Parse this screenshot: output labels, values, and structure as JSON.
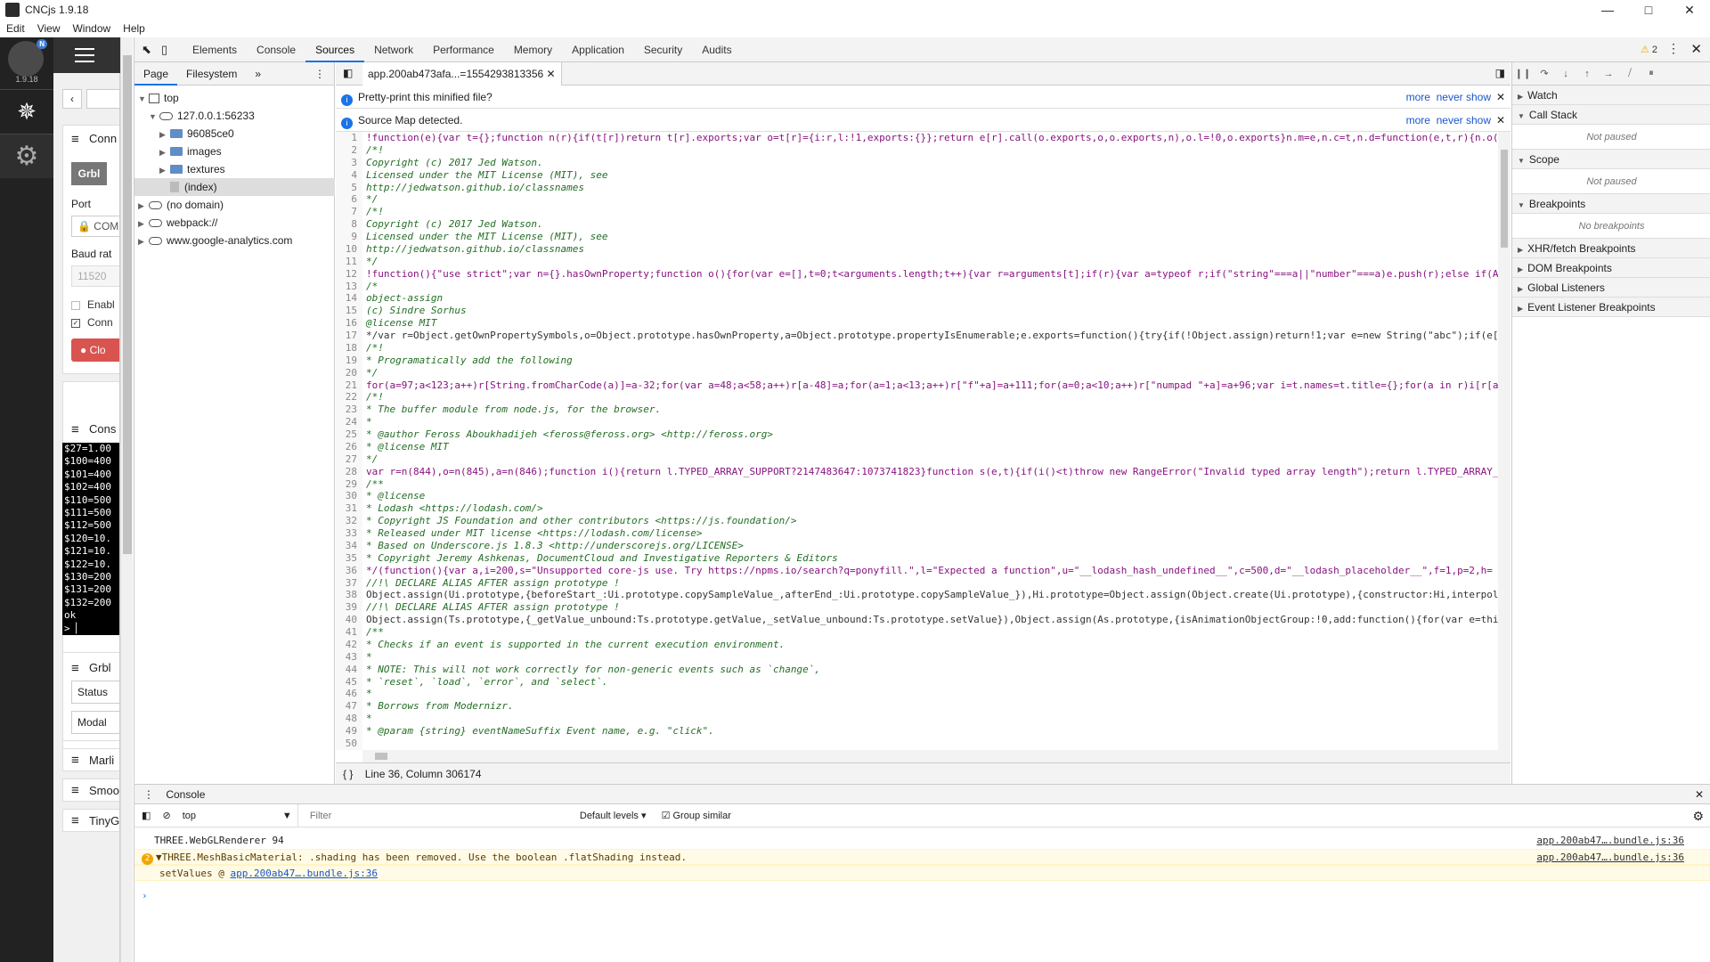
{
  "window": {
    "title": "CNCjs 1.9.18",
    "controls": [
      "—",
      "□",
      "✕"
    ]
  },
  "menu": [
    "Edit",
    "View",
    "Window",
    "Help"
  ],
  "cnc": {
    "version": "1.9.18",
    "logo_badge": "N",
    "widgets": {
      "connection_title": "Conn",
      "controller_button": "Grbl",
      "port_label": "Port",
      "port_value": "COM",
      "baud_label": "Baud rat",
      "baud_value": "11520",
      "enable_label": "Enabl",
      "conn_label": "Conn",
      "close_button": "Clo",
      "console_title": "Cons",
      "console_lines": [
        "$27=1.00",
        "$100=400",
        "$101=400",
        "$102=400",
        "$110=500",
        "$111=500",
        "$112=500",
        "$120=10.",
        "$121=10.",
        "$122=10.",
        "$130=200",
        "$131=200",
        "$132=200",
        "ok",
        "> ▏"
      ],
      "grbl_title": "Grbl",
      "status_tab": "Status",
      "modal_tab": "Modal",
      "marlin_title": "Marli",
      "smoothie_title": "Smoo",
      "tinyg_title": "TinyG"
    }
  },
  "devtools": {
    "tabs": [
      "Elements",
      "Console",
      "Sources",
      "Network",
      "Performance",
      "Memory",
      "Application",
      "Security",
      "Audits"
    ],
    "active_tab": "Sources",
    "warning_count": "2",
    "navigator": {
      "tabs": [
        "Page",
        "Filesystem"
      ],
      "tree": [
        {
          "label": "top",
          "level": 0,
          "icon": "frame",
          "arrow": "▼"
        },
        {
          "label": "127.0.0.1:56233",
          "level": 1,
          "icon": "cloud",
          "arrow": "▼"
        },
        {
          "label": "96085ce0",
          "level": 2,
          "icon": "folder",
          "arrow": "▶"
        },
        {
          "label": "images",
          "level": 2,
          "icon": "folder",
          "arrow": "▶"
        },
        {
          "label": "textures",
          "level": 2,
          "icon": "folder",
          "arrow": "▶"
        },
        {
          "label": "(index)",
          "level": 2,
          "icon": "file",
          "arrow": "",
          "selected": true
        },
        {
          "label": "(no domain)",
          "level": 0,
          "icon": "cloud",
          "arrow": "▶"
        },
        {
          "label": "webpack://",
          "level": 0,
          "icon": "cloud",
          "arrow": "▶"
        },
        {
          "label": "www.google-analytics.com",
          "level": 0,
          "icon": "cloud",
          "arrow": "▶"
        }
      ]
    },
    "editor": {
      "file_tab": "app.200ab473afa...=1554293813356",
      "infobars": [
        {
          "text": "Pretty-print this minified file?",
          "more": "more",
          "never": "never show"
        },
        {
          "text": "Source Map detected.",
          "more": "more",
          "never": "never show"
        }
      ],
      "lines": [
        {
          "n": "1",
          "t": "!function(e){var t={};function n(r){if(t[r])return t[r].exports;var o=t[r]={i:r,l:!1,exports:{}};return e[r].call(o.exports,o,o.exports,n),o.l=!0,o.exports}n.m=e,n.c=t,n.d=function(e,t,r){n.o(",
          "c": "k"
        },
        {
          "n": "2",
          "t": "/*!",
          "c": "c"
        },
        {
          "n": "3",
          "t": "  Copyright (c) 2017 Jed Watson.",
          "c": "c"
        },
        {
          "n": "4",
          "t": "  Licensed under the MIT License (MIT), see",
          "c": "c"
        },
        {
          "n": "5",
          "t": "  http://jedwatson.github.io/classnames",
          "c": "c"
        },
        {
          "n": "6",
          "t": "*/",
          "c": "c"
        },
        {
          "n": "7",
          "t": "/*!",
          "c": "c"
        },
        {
          "n": "8",
          "t": "  Copyright (c) 2017 Jed Watson.",
          "c": "c"
        },
        {
          "n": "9",
          "t": "  Licensed under the MIT License (MIT), see",
          "c": "c"
        },
        {
          "n": "10",
          "t": "  http://jedwatson.github.io/classnames",
          "c": "c"
        },
        {
          "n": "11",
          "t": "*/",
          "c": "c"
        },
        {
          "n": "12",
          "t": "!function(){\"use strict\";var n={}.hasOwnProperty;function o(){for(var e=[],t=0;t<arguments.length;t++){var r=arguments[t];if(r){var a=typeof r;if(\"string\"===a||\"number\"===a)e.push(r);else if(A",
          "c": "k"
        },
        {
          "n": "13",
          "t": "/*",
          "c": "c"
        },
        {
          "n": "14",
          "t": "object-assign",
          "c": "c"
        },
        {
          "n": "15",
          "t": "(c) Sindre Sorhus",
          "c": "c"
        },
        {
          "n": "16",
          "t": "@license MIT",
          "c": "c"
        },
        {
          "n": "17",
          "t": "*/var r=Object.getOwnPropertySymbols,o=Object.prototype.hasOwnProperty,a=Object.prototype.propertyIsEnumerable;e.exports=function(){try{if(!Object.assign)return!1;var e=new String(\"abc\");if(e[",
          "c": ""
        },
        {
          "n": "18",
          "t": "/*!",
          "c": "c"
        },
        {
          "n": "19",
          "t": " * Programatically add the following",
          "c": "c"
        },
        {
          "n": "20",
          "t": " */",
          "c": "c"
        },
        {
          "n": "21",
          "t": "for(a=97;a<123;a++)r[String.fromCharCode(a)]=a-32;for(var a=48;a<58;a++)r[a-48]=a;for(a=1;a<13;a++)r[\"f\"+a]=a+111;for(a=0;a<10;a++)r[\"numpad \"+a]=a+96;var i=t.names=t.title={};for(a in r)i[r[a",
          "c": "k"
        },
        {
          "n": "22",
          "t": "/*!",
          "c": "c"
        },
        {
          "n": "23",
          "t": " * The buffer module from node.js, for the browser.",
          "c": "c"
        },
        {
          "n": "24",
          "t": " *",
          "c": "c"
        },
        {
          "n": "25",
          "t": " * @author   Feross Aboukhadijeh <feross@feross.org> <http://feross.org>",
          "c": "c"
        },
        {
          "n": "26",
          "t": " * @license  MIT",
          "c": "c"
        },
        {
          "n": "27",
          "t": " */",
          "c": "c"
        },
        {
          "n": "28",
          "t": "var r=n(844),o=n(845),a=n(846);function i(){return l.TYPED_ARRAY_SUPPORT?2147483647:1073741823}function s(e,t){if(i()<t)throw new RangeError(\"Invalid typed array length\");return l.TYPED_ARRAY_",
          "c": "k"
        },
        {
          "n": "29",
          "t": "/**",
          "c": "c"
        },
        {
          "n": "30",
          "t": " * @license",
          "c": "c"
        },
        {
          "n": "31",
          "t": " * Lodash <https://lodash.com/>",
          "c": "c"
        },
        {
          "n": "32",
          "t": " * Copyright JS Foundation and other contributors <https://js.foundation/>",
          "c": "c"
        },
        {
          "n": "33",
          "t": " * Released under MIT license <https://lodash.com/license>",
          "c": "c"
        },
        {
          "n": "34",
          "t": " * Based on Underscore.js 1.8.3 <http://underscorejs.org/LICENSE>",
          "c": "c"
        },
        {
          "n": "35",
          "t": " * Copyright Jeremy Ashkenas, DocumentCloud and Investigative Reporters & Editors",
          "c": "c"
        },
        {
          "n": "36",
          "t": " */(function(){var a,i=200,s=\"Unsupported core-js use. Try https://npms.io/search?q=ponyfill.\",l=\"Expected a function\",u=\"__lodash_hash_undefined__\",c=500,d=\"__lodash_placeholder__\",f=1,p=2,h=",
          "c": "k"
        },
        {
          "n": "37",
          "t": "//!\\ DECLARE ALIAS AFTER assign prototype !",
          "c": "c"
        },
        {
          "n": "38",
          "t": "Object.assign(Ui.prototype,{beforeStart_:Ui.prototype.copySampleValue_,afterEnd_:Ui.prototype.copySampleValue_}),Hi.prototype=Object.assign(Object.create(Ui.prototype),{constructor:Hi,interpol",
          "c": ""
        },
        {
          "n": "39",
          "t": "//!\\ DECLARE ALIAS AFTER assign prototype !",
          "c": "c"
        },
        {
          "n": "40",
          "t": "Object.assign(Ts.prototype,{_getValue_unbound:Ts.prototype.getValue,_setValue_unbound:Ts.prototype.setValue}),Object.assign(As.prototype,{isAnimationObjectGroup:!0,add:function(){for(var e=thi",
          "c": ""
        },
        {
          "n": "41",
          "t": "/**",
          "c": "c"
        },
        {
          "n": "42",
          "t": " * Checks if an event is supported in the current execution environment.",
          "c": "c"
        },
        {
          "n": "43",
          "t": " *",
          "c": "c"
        },
        {
          "n": "44",
          "t": " * NOTE: This will not work correctly for non-generic events such as `change`,",
          "c": "c"
        },
        {
          "n": "45",
          "t": " * `reset`, `load`, `error`, and `select`.",
          "c": "c"
        },
        {
          "n": "46",
          "t": " *",
          "c": "c"
        },
        {
          "n": "47",
          "t": " * Borrows from Modernizr.",
          "c": "c"
        },
        {
          "n": "48",
          "t": " *",
          "c": "c"
        },
        {
          "n": "49",
          "t": " * @param {string} eventNameSuffix Event name, e.g. \"click\".",
          "c": "c"
        },
        {
          "n": "50",
          "t": "",
          "c": "c"
        }
      ],
      "status": "Line 36, Column 306174"
    },
    "debugger": {
      "sections": [
        {
          "label": "Watch"
        },
        {
          "label": "Call Stack",
          "empty": "Not paused"
        },
        {
          "label": "Scope",
          "empty": "Not paused"
        },
        {
          "label": "Breakpoints",
          "empty": "No breakpoints"
        },
        {
          "label": "XHR/fetch Breakpoints"
        },
        {
          "label": "DOM Breakpoints"
        },
        {
          "label": "Global Listeners"
        },
        {
          "label": "Event Listener Breakpoints"
        }
      ]
    },
    "console": {
      "tab": "Console",
      "context": "top",
      "filter_placeholder": "Filter",
      "levels": "Default levels",
      "group_similar": "Group similar",
      "messages": [
        {
          "text": "THREE.WebGLRenderer 94",
          "src": "app.200ab47….bundle.js:36"
        },
        {
          "text": "▼THREE.MeshBasicMaterial: .shading has been removed. Use the boolean .flatShading instead.",
          "src": "app.200ab47….bundle.js:36",
          "count": "2"
        },
        {
          "text": "setValues @ ",
          "link": "app.200ab47….bundle.js:36"
        }
      ],
      "prompt": "›"
    }
  }
}
